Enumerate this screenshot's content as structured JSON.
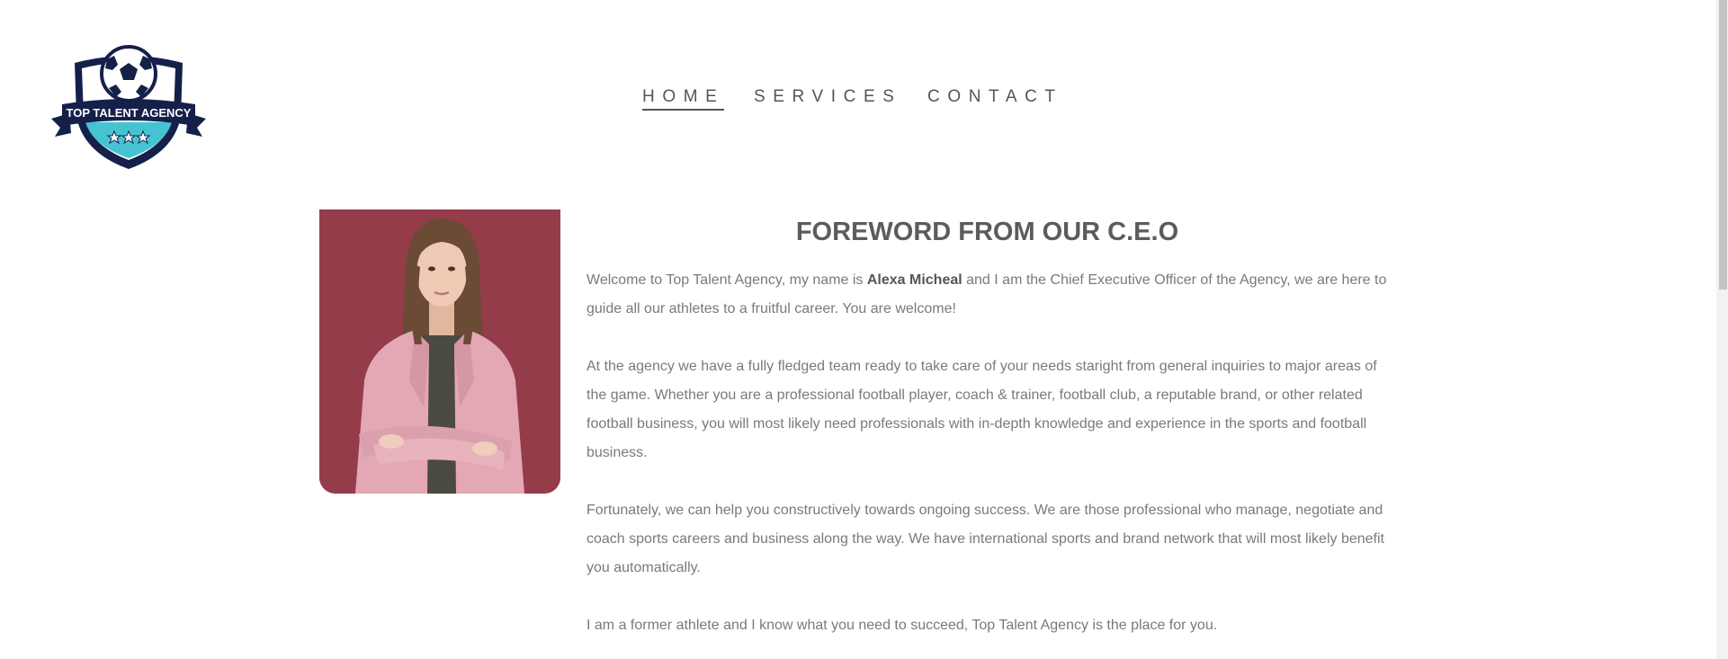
{
  "logo": {
    "text": "TOP TALENT AGENCY"
  },
  "nav": {
    "items": [
      {
        "label": "HOME",
        "active": true
      },
      {
        "label": "SERVICES",
        "active": false
      },
      {
        "label": "CONTACT",
        "active": false
      }
    ]
  },
  "foreword": {
    "title": "FOREWORD FROM OUR C.E.O",
    "p1_before": "Welcome to Top Talent Agency, my name is ",
    "p1_name": "Alexa Micheal",
    "p1_after": " and I am the Chief Executive Officer of the Agency, we are here to guide all our athletes to a fruitful career. You are welcome!",
    "p2": "At the agency we have a fully fledged team ready to take care of your needs staright from general inquiries to major areas of the game. Whether you are a professional football player, coach & trainer, football club, a reputable brand, or other related football business, you will most likely need professionals with in-depth knowledge and experience in the sports and football business.",
    "p3": "Fortunately, we can help you constructively towards ongoing success. We are those professional who manage, negotiate and coach sports careers and business along the way. We have international sports and brand network that will most likely benefit you automatically.",
    "p4": "I am a former athlete and I know what you need to succeed, Top Talent Agency is the place for you."
  },
  "colors": {
    "navy": "#15204a",
    "teal": "#45c3d0",
    "photo_bg": "#8f3a47",
    "jacket": "#e3a8b3",
    "text": "#7a7a7a"
  }
}
